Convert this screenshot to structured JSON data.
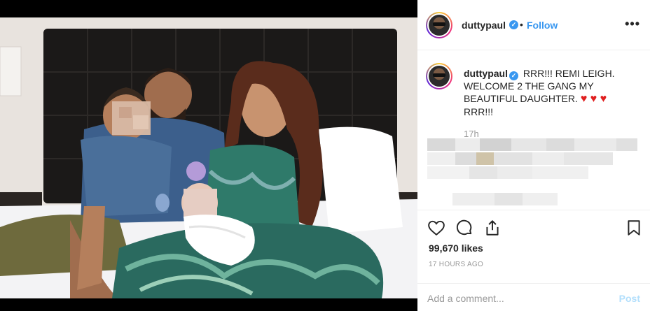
{
  "post": {
    "username": "duttypaul",
    "verified_mark": "✓",
    "separator": "•",
    "follow_label": "Follow",
    "more_label": "•••",
    "caption_text": "RRR!!! REMI LEIGH. WELCOME 2 THE GANG MY BEAUTIFUL DAUGHTER.",
    "caption_hearts": "♥ ♥ ♥",
    "caption_end": "RRR!!!",
    "caption_time": "17h",
    "likes": "99,670 likes",
    "posted_ago": "17 HOURS AGO",
    "comment_placeholder": "Add a comment...",
    "post_label": "Post"
  },
  "icons": [
    "like-icon",
    "comment-icon",
    "share-icon",
    "save-icon"
  ],
  "colors": {
    "accent": "#3897f0",
    "heart": "#e02020",
    "muted": "#999999",
    "post_disabled": "#b2dffc"
  }
}
